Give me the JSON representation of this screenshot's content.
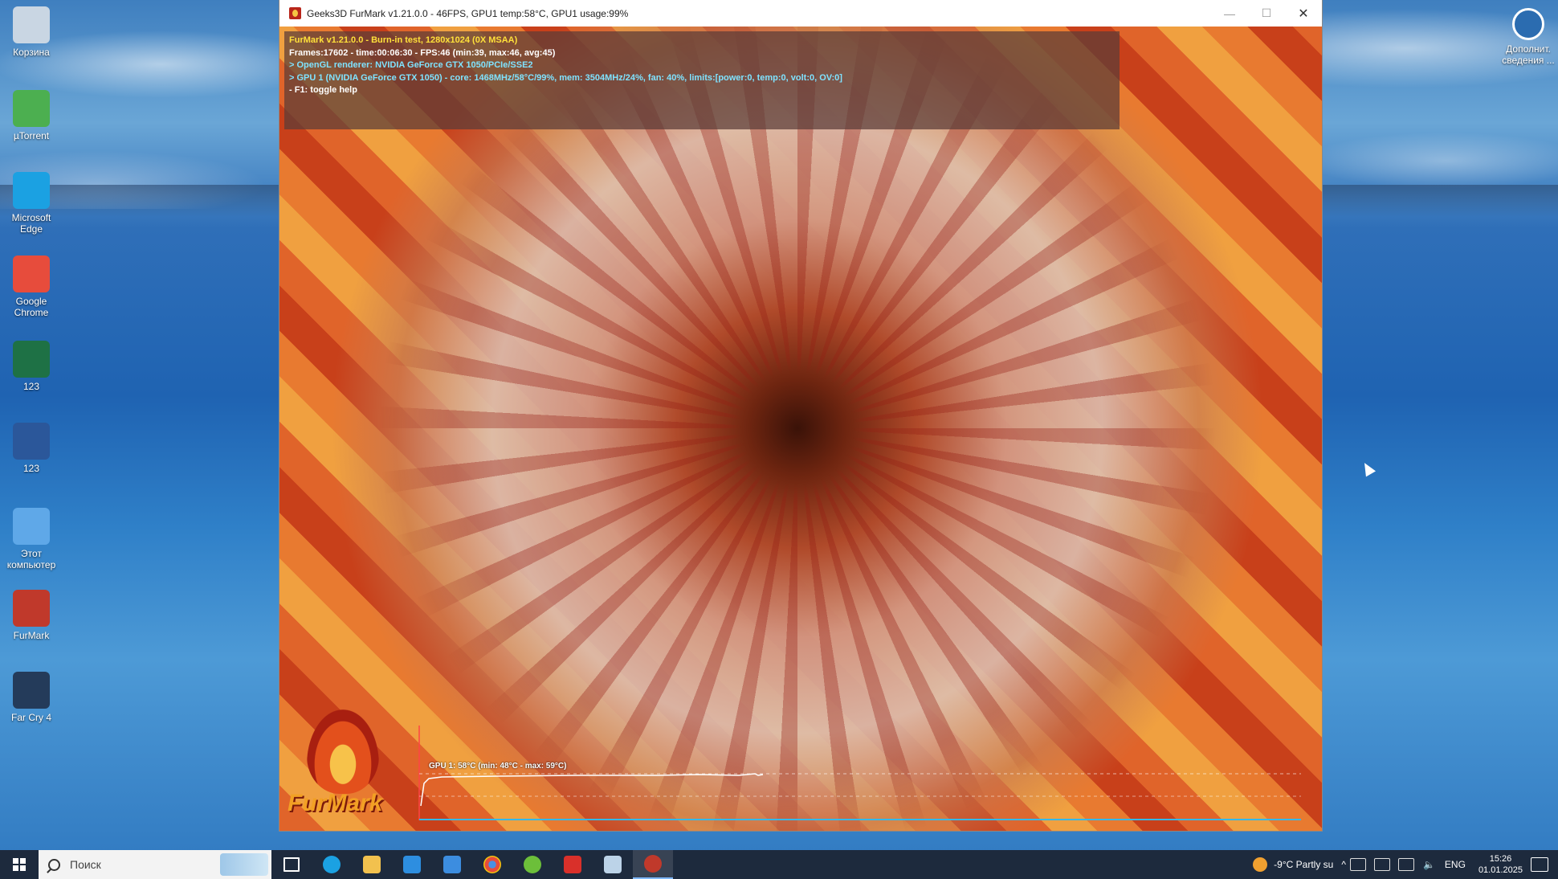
{
  "desktop": {
    "icons": [
      {
        "label": "Корзина",
        "icon": "recycle-bin-icon",
        "color": "#c9d6e3"
      },
      {
        "label": "µTorrent",
        "icon": "utorrent-icon",
        "color": "#4caf50"
      },
      {
        "label": "Microsoft Edge",
        "icon": "edge-icon",
        "color": "#1ba1e2"
      },
      {
        "label": "Google Chrome",
        "icon": "chrome-icon",
        "color": "#e74c3c"
      },
      {
        "label": "123",
        "icon": "excel-icon",
        "color": "#1e7145"
      },
      {
        "label": "123",
        "icon": "word-icon",
        "color": "#2b579a"
      },
      {
        "label": "Этот компьютер",
        "icon": "computer-icon",
        "color": "#5fa8e8"
      },
      {
        "label": "FurMark",
        "icon": "furmark-icon",
        "color": "#c0392b"
      },
      {
        "label": "Far Cry 4",
        "icon": "farcry4-icon",
        "color": "#243b5a"
      }
    ],
    "right_icon": {
      "label": "Дополнит. сведения ...",
      "icon": "info-account-icon"
    }
  },
  "window": {
    "title": "Geeks3D FurMark v1.21.0.0 - 46FPS, GPU1 temp:58°C, GPU1 usage:99%",
    "minimize": "—",
    "maximize": "☐",
    "close": "✕"
  },
  "osd": {
    "line1": "FurMark v1.21.0.0 - Burn-in test, 1280x1024 (0X MSAA)",
    "line2": "Frames:17602 - time:00:06:30 - FPS:46 (min:39, max:46, avg:45)",
    "line3": "> OpenGL renderer: NVIDIA GeForce GTX 1050/PCIe/SSE2",
    "line4": "> GPU 1 (NVIDIA GeForce GTX 1050) - core: 1468MHz/58°C/99%, mem: 3504MHz/24%, fan: 40%, limits:[power:0, temp:0, volt:0, OV:0]",
    "line5": "- F1: toggle help"
  },
  "graph": {
    "label": "GPU 1: 58°C (min: 48°C - max: 59°C)"
  },
  "logo_text": "FurMark",
  "taskbar": {
    "search_placeholder": "Поиск",
    "weather": "-9°C  Partly su",
    "language": "ENG",
    "time": "15:26",
    "date": "01.01.2025"
  }
}
